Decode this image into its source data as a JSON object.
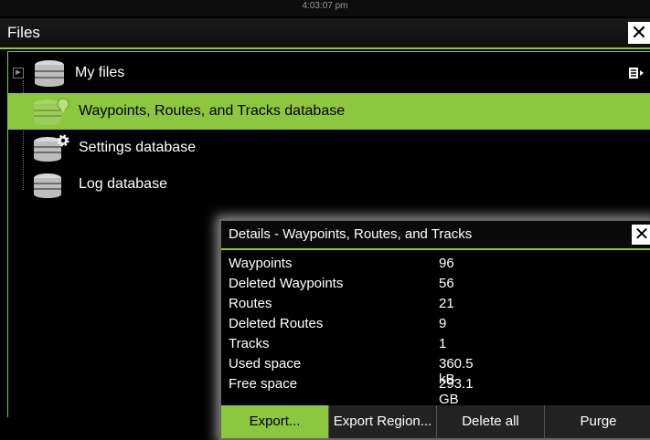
{
  "status": {
    "time": "4:03:07 pm"
  },
  "window": {
    "title": "Files",
    "close_label": "✕"
  },
  "tree": {
    "items": [
      {
        "label": "My files"
      },
      {
        "label": "Waypoints, Routes, and Tracks database"
      },
      {
        "label": "Settings database"
      },
      {
        "label": "Log database"
      }
    ]
  },
  "dialog": {
    "title": "Details - Waypoints, Routes, and Tracks",
    "close_label": "✕",
    "rows": [
      {
        "key": "Waypoints",
        "value": "96"
      },
      {
        "key": "Deleted Waypoints",
        "value": "56"
      },
      {
        "key": "Routes",
        "value": "21"
      },
      {
        "key": "Deleted Routes",
        "value": "9"
      },
      {
        "key": "Tracks",
        "value": "1"
      },
      {
        "key": "Used space",
        "value": "360.5 kB"
      },
      {
        "key": "Free space",
        "value": "293.1 GB"
      }
    ],
    "buttons": [
      {
        "label": "Export..."
      },
      {
        "label": "Export Region..."
      },
      {
        "label": "Delete all"
      },
      {
        "label": "Purge"
      }
    ]
  },
  "colors": {
    "accent": "#8dc63f",
    "background": "#000000"
  }
}
